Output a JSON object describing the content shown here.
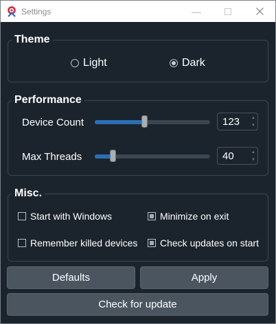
{
  "window": {
    "title": "Settings"
  },
  "theme": {
    "title": "Theme",
    "options": [
      {
        "label": "Light",
        "checked": false
      },
      {
        "label": "Dark",
        "checked": true
      }
    ]
  },
  "performance": {
    "title": "Performance",
    "device_count": {
      "label": "Device Count",
      "value": "123"
    },
    "max_threads": {
      "label": "Max Threads",
      "value": "40"
    }
  },
  "misc": {
    "title": "Misc.",
    "checkboxes": [
      {
        "label": "Start with Windows",
        "checked": false
      },
      {
        "label": "Minimize on exit",
        "checked": true
      },
      {
        "label": "Remember killed devices",
        "checked": false
      },
      {
        "label": "Check updates on start",
        "checked": true
      }
    ]
  },
  "buttons": {
    "defaults": "Defaults",
    "apply": "Apply",
    "check_update": "Check for update"
  },
  "icons": {
    "minimize": "minimize-icon",
    "maximize": "maximize-icon",
    "close": "close-icon",
    "app": "app-logo-icon"
  },
  "colors": {
    "background": "#1b242d",
    "accent": "#2c6fb3",
    "button": "#4a5560"
  }
}
